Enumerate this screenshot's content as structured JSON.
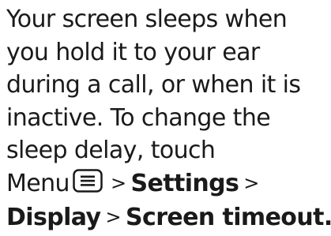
{
  "paragraph": {
    "lines": [
      "Your screen sleeps when",
      "you hold it to your ear",
      "during a call, or when it is",
      "inactive. To change the",
      "sleep delay, touch"
    ],
    "menu_label": "Menu",
    "menu_icon": "menu-icon",
    "separator": ">",
    "settings_label": "Settings",
    "display_label": "Display",
    "screen_timeout_label": "Screen timeout."
  }
}
